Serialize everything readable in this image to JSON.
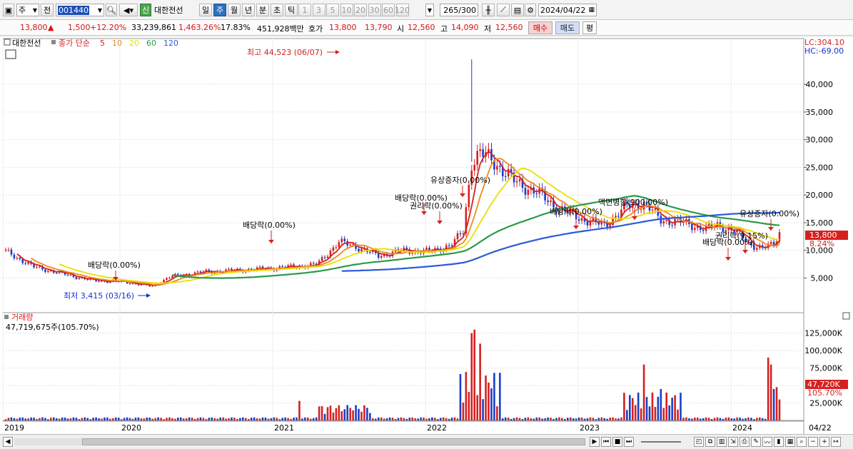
{
  "toolbar": {
    "market_type": "주",
    "mode": "전",
    "stock_code": "001440",
    "badge": "신",
    "stock_name": "대한전선",
    "periods": [
      "일",
      "주",
      "월",
      "년",
      "분",
      "초",
      "틱"
    ],
    "active_period": "주",
    "intervals": [
      "1",
      "3",
      "5",
      "10",
      "20",
      "30",
      "60",
      "120"
    ],
    "count_current": "265",
    "count_total": "/300",
    "date": "2024/04/22"
  },
  "quote": {
    "price": "13,800",
    "change_arrow": "▲",
    "change": "1,500",
    "change_pct": "+12.20%",
    "volume": "33,239,861",
    "volume_pct": "1,463.26%",
    "turnover": "17.83%",
    "amount": "451,928백만",
    "ask_label": "호가",
    "ask1": "13,800",
    "ask2": "13,790",
    "open_label": "시",
    "open": "12,560",
    "high_label": "고",
    "high": "14,090",
    "low_label": "저",
    "low": "12,560",
    "buy_label": "매수",
    "sell_label": "매도",
    "eval_label": "평"
  },
  "legend": {
    "name": "대한전선",
    "type": "종가 단순",
    "ma_periods": [
      "5",
      "10",
      "20",
      "60",
      "120"
    ],
    "ma_colors": [
      "#d62020",
      "#f08a1a",
      "#e8e000",
      "#2a9a4a",
      "#2a5ad8"
    ]
  },
  "price_panel": {
    "lc": "LC:304.10",
    "hc": "HC:-69.00",
    "current_tag": "13,800",
    "current_pct": "8.24%",
    "max_label": "최고 44,523 (06/07)",
    "min_label": "최저 3,415 (03/16)",
    "annotations": [
      "배당락(0.00%)",
      "배당락(0.00%)",
      "유상증자(0.00%)",
      "배당락(0.00%)",
      "권리락(0.00%)",
      "배당락(0.00%)",
      "액면병합(900.00%)",
      "권리락(9.15%)",
      "배당락(0.00%)",
      "유상증자(0.00%)"
    ],
    "y_ticks": [
      "40,000",
      "35,000",
      "30,000",
      "25,000",
      "20,000",
      "15,000",
      "10,000",
      "5,000"
    ]
  },
  "volume_panel": {
    "title": "거래량",
    "summary": "47,719,675주(105.70%)",
    "current_tag": "47,720K",
    "current_pct": "105.70%",
    "y_ticks": [
      "125,000K",
      "100,000K",
      "75,000K",
      "50,000K",
      "25,000K"
    ]
  },
  "x_axis": {
    "labels": [
      "2019",
      "2020",
      "2021",
      "2022",
      "2023",
      "2024"
    ],
    "end_label": "04/22"
  },
  "colors": {
    "up": "#d62020",
    "down": "#1a3fc8",
    "grid": "#e3e3e3",
    "accent": "#2f6fc0"
  }
}
